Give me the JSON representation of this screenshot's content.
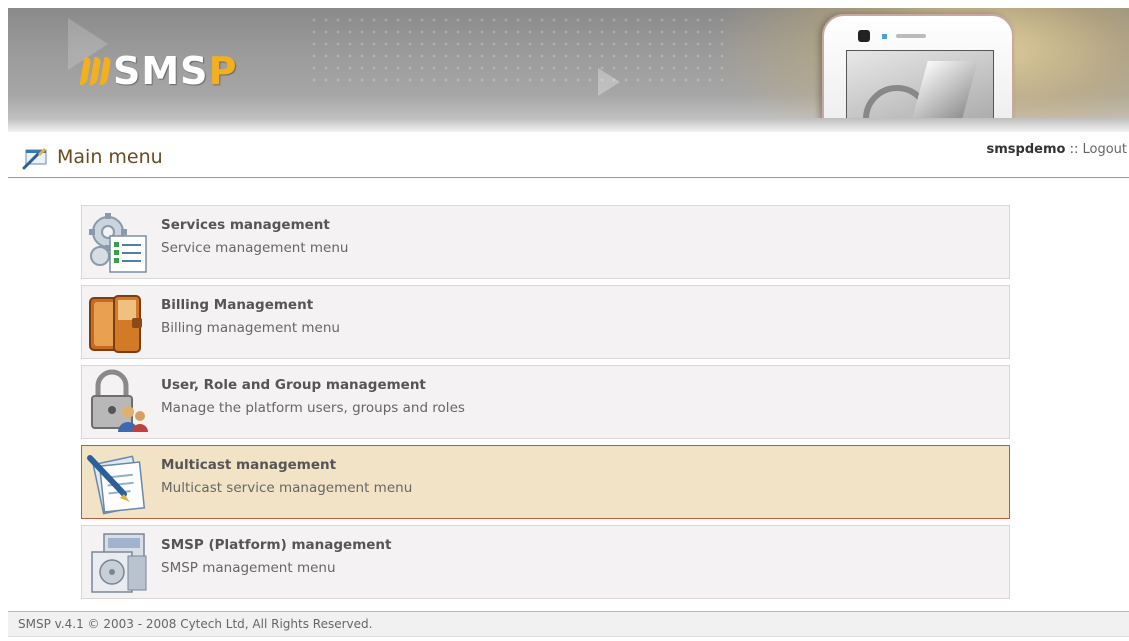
{
  "banner": {
    "logo_text_main": "SMS",
    "logo_text_accent": "P",
    "brand_accent_color": "#f2b01e"
  },
  "header": {
    "title": "Main menu",
    "title_icon": "menu-icon",
    "username": "smspdemo",
    "separator": " :: ",
    "logout_label": "Logout"
  },
  "menu": {
    "items": [
      {
        "title": "Services management",
        "description": "Service management menu",
        "icon": "services-gear-checklist-icon"
      },
      {
        "title": "Billing Management",
        "description": "Billing management menu",
        "icon": "wallet-icon"
      },
      {
        "title": "User, Role and Group management",
        "description": "Manage the platform users, groups and roles",
        "icon": "padlock-users-icon"
      },
      {
        "title": "Multicast management",
        "description": "Multicast service management menu",
        "icon": "pen-document-icon"
      },
      {
        "title": "SMSP (Platform) management",
        "description": "SMSP management menu",
        "icon": "platform-box-icon"
      }
    ],
    "active_index": 3,
    "active_bg": "#f2e2c6",
    "active_border": "#b85a3c"
  },
  "footer": {
    "copyright": "SMSP v.4.1 © 2003 - 2008 Cytech Ltd, All Rights Reserved."
  }
}
